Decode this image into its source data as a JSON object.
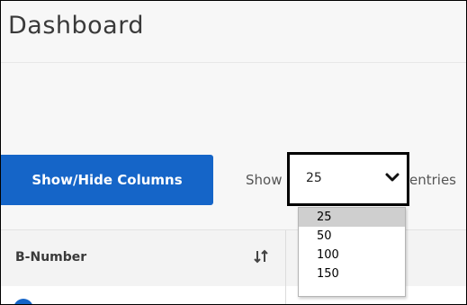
{
  "header": {
    "title": "Dashboard"
  },
  "toolbar": {
    "show_hide_label": "Show/Hide Columns",
    "show_label": "Show",
    "entries_label": "entries"
  },
  "page_size": {
    "selected": "25",
    "options": [
      "25",
      "50",
      "100",
      "150"
    ],
    "chevron_icon": "chevron-down-icon"
  },
  "table": {
    "columns": [
      {
        "label": "B-Number",
        "sort_icon": "sort-icon"
      }
    ]
  },
  "colors": {
    "accent": "#1565c8",
    "background": "#f7f7f7",
    "title_text": "#3a3a3a",
    "selected_option": "#cfcfcf"
  }
}
